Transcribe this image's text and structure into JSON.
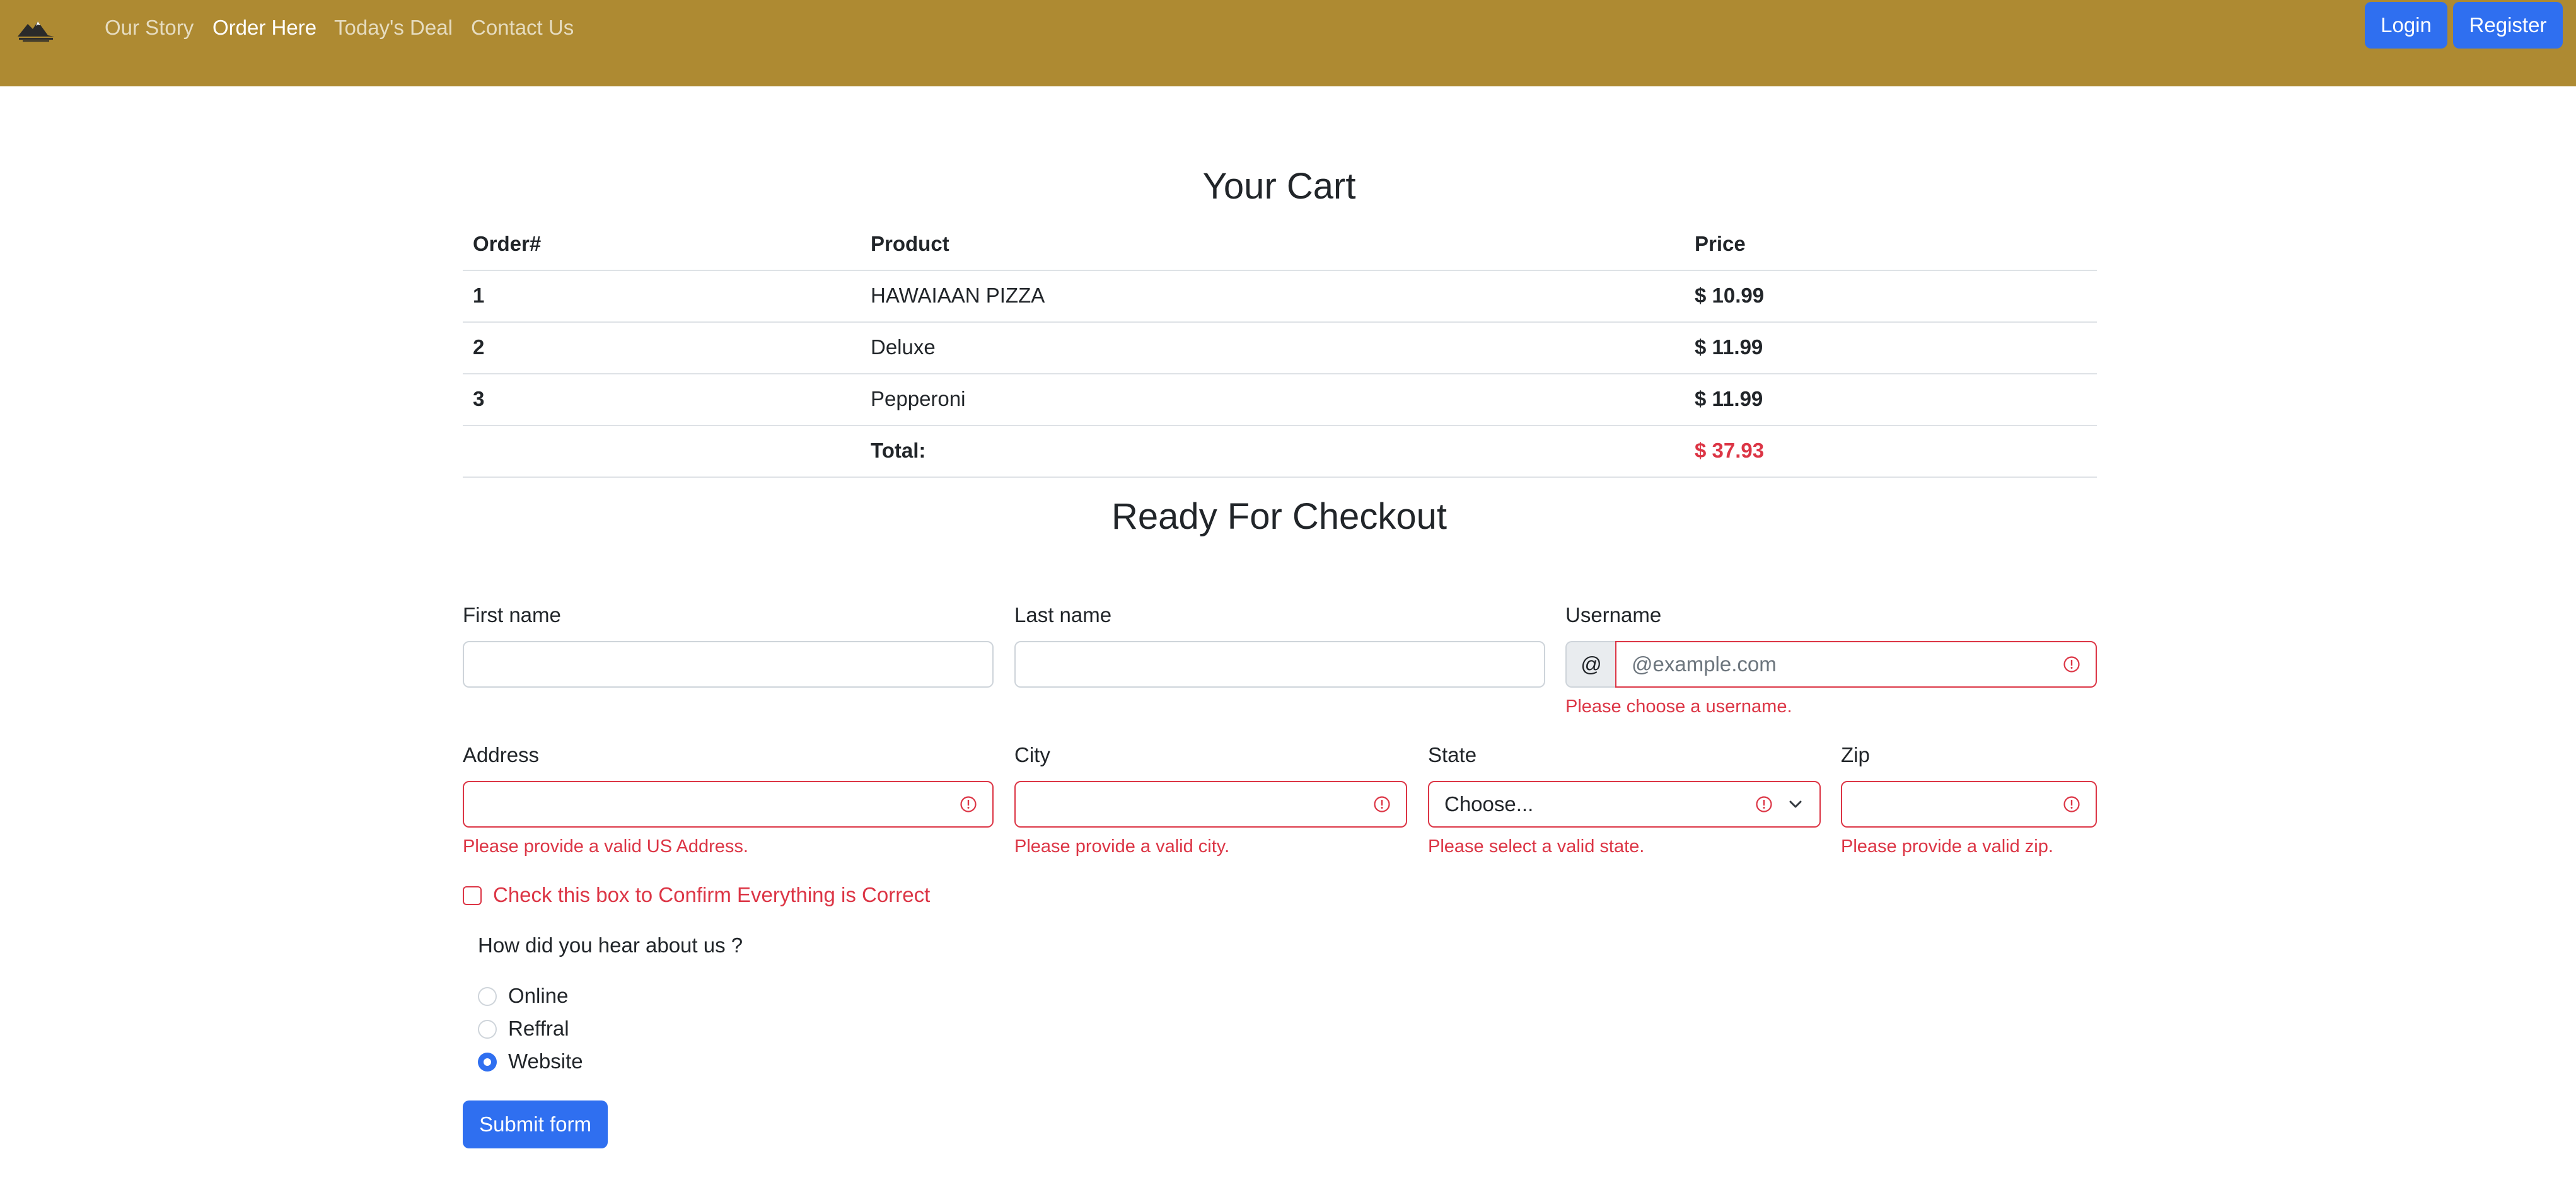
{
  "nav": {
    "brand_logo_icon": "mountain-logo-icon",
    "links": [
      "Our Story",
      "Order Here",
      "Today's Deal",
      "Contact Us"
    ],
    "active": "Order Here",
    "login": "Login",
    "register": "Register"
  },
  "cart": {
    "title": "Your Cart",
    "headers": [
      "Order#",
      "Product",
      "Price"
    ],
    "rows": [
      {
        "order": "1",
        "product": "HAWAIAAN PIZZA",
        "price": "$ 10.99"
      },
      {
        "order": "2",
        "product": "Deluxe",
        "price": "$ 11.99"
      },
      {
        "order": "3",
        "product": "Pepperoni",
        "price": "$ 11.99"
      }
    ],
    "total_label": "Total:",
    "total_value": "$ 37.93"
  },
  "checkout": {
    "title": "Ready For Checkout",
    "first_name": {
      "label": "First name",
      "value": ""
    },
    "last_name": {
      "label": "Last name",
      "value": ""
    },
    "username": {
      "label": "Username",
      "prefix": "@",
      "placeholder": "@example.com",
      "feedback": "Please choose a username."
    },
    "address": {
      "label": "Address",
      "value": "",
      "feedback": "Please provide a valid US Address."
    },
    "city": {
      "label": "City",
      "value": "",
      "feedback": "Please provide a valid city."
    },
    "state": {
      "label": "State",
      "selected": "Choose...",
      "feedback": "Please select a valid state."
    },
    "zip": {
      "label": "Zip",
      "value": "",
      "feedback": "Please provide a valid zip."
    },
    "confirm": {
      "label": "Check this box to Confirm Everything is Correct",
      "checked": false
    },
    "heard_question": "How did you hear about us ?",
    "heard_options": [
      "Online",
      "Reffral",
      "Website"
    ],
    "heard_selected": "Website",
    "submit": "Submit form"
  },
  "colors": {
    "navbar": "#ae8a32",
    "primary": "#2f6ff0",
    "danger": "#dc3545"
  }
}
